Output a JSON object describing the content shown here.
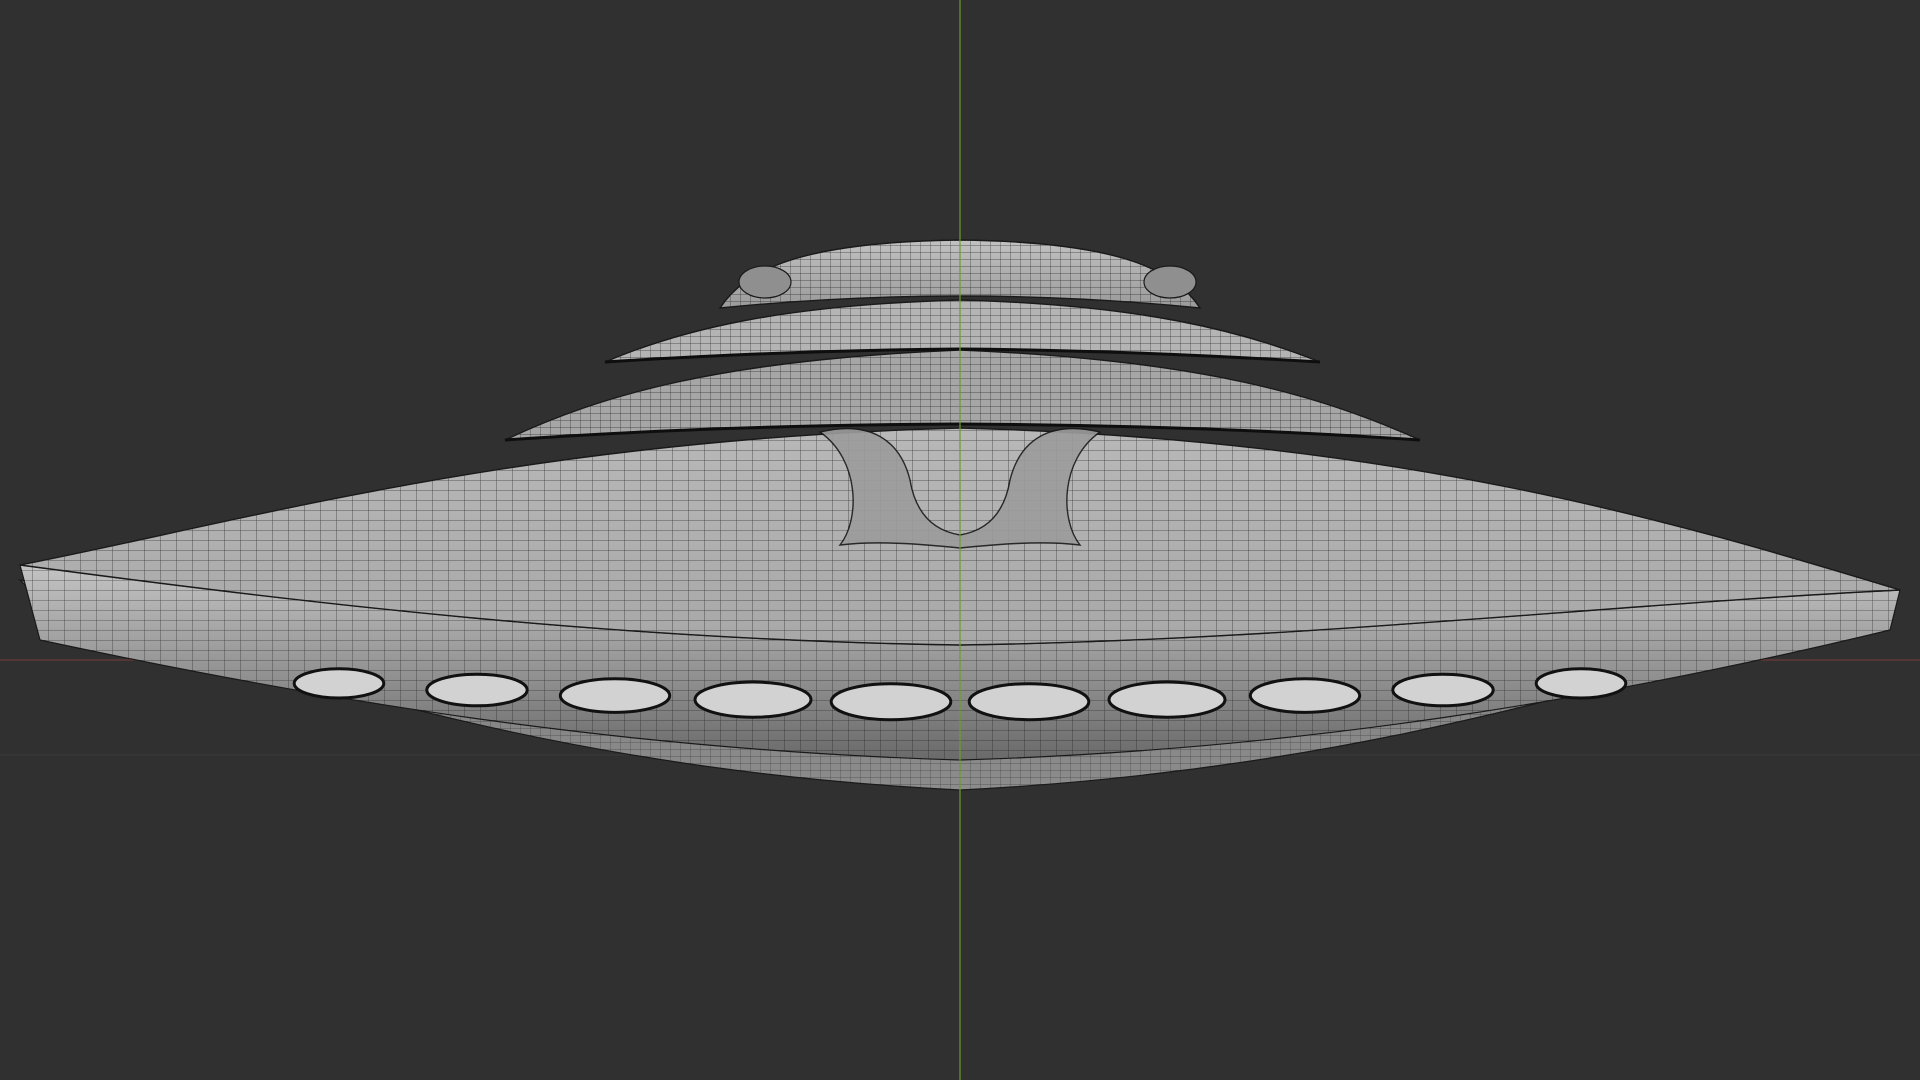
{
  "viewport": {
    "background_color": "#303030",
    "x_axis_color": "#7a3a3a",
    "y_axis_color": "#6e9b2c",
    "grid_color": "#3a3a3a"
  },
  "model": {
    "type": "flying-saucer-mesh",
    "display": "wireframe-on-solid",
    "surface_color": "#9e9e9e",
    "wire_color": "#1a1a1a",
    "porthole_count": 10
  }
}
